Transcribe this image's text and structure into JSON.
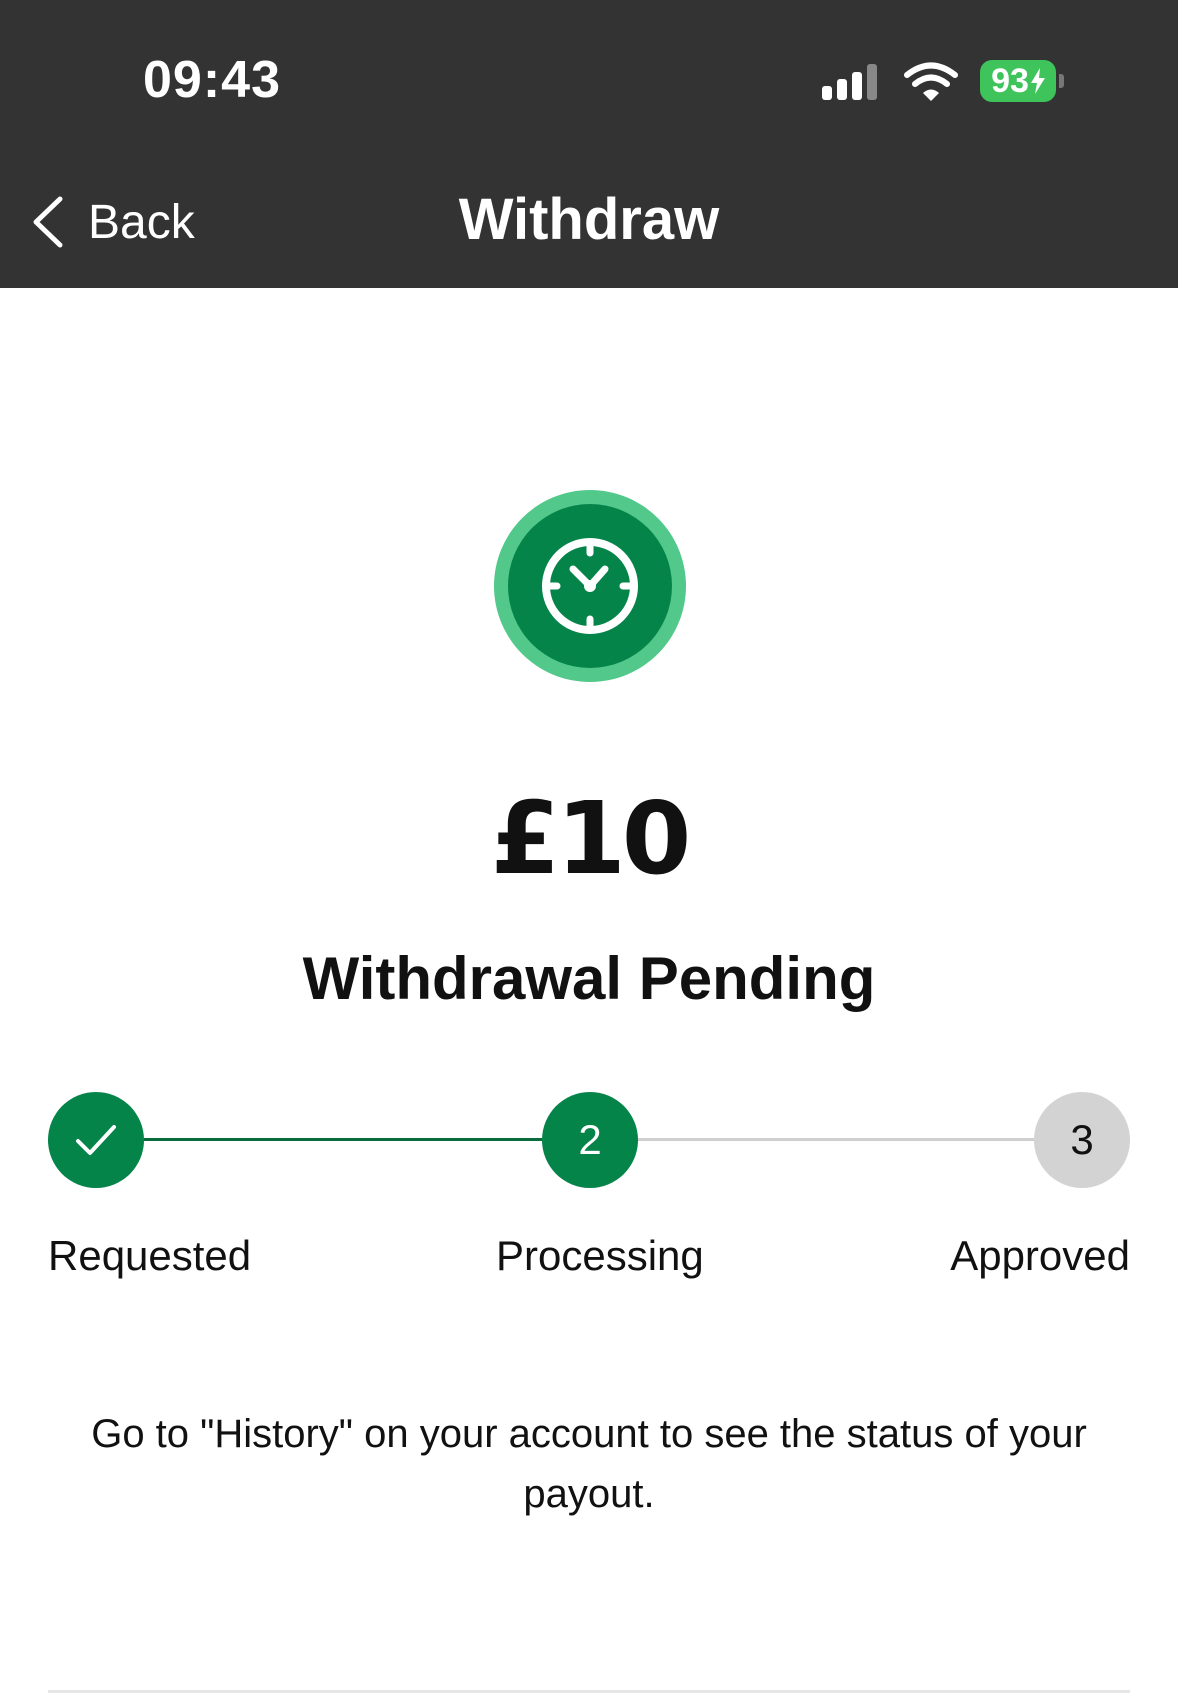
{
  "status_bar": {
    "time": "09:43",
    "battery": "93",
    "icons": [
      "signal-icon",
      "wifi-icon",
      "battery-charging-icon"
    ]
  },
  "nav": {
    "back_label": "Back",
    "title": "Withdraw"
  },
  "withdrawal": {
    "status_icon": "clock-pending-icon",
    "amount": "£10",
    "headline": "Withdrawal Pending"
  },
  "stepper": {
    "current_step": 2,
    "steps": [
      {
        "marker": "✓",
        "label": "Requested",
        "state": "complete"
      },
      {
        "marker": "2",
        "label": "Processing",
        "state": "active"
      },
      {
        "marker": "3",
        "label": "Approved",
        "state": "pending"
      }
    ]
  },
  "info": {
    "message": "Go to \"History\" on your account to see the status of your payout."
  },
  "colors": {
    "header_bg": "#333333",
    "brand_green": "#05844a",
    "light_green": "#52c98b",
    "battery_green": "#3ec45a",
    "inactive_grey": "#d3d3d3"
  }
}
